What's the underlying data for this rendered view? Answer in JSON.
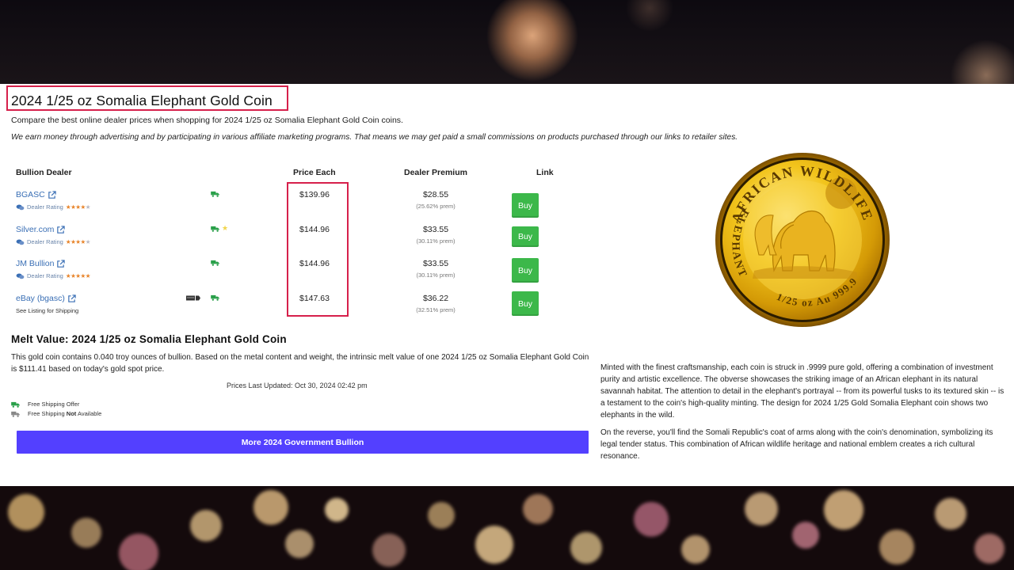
{
  "page": {
    "title": "2024 1/25 oz Somalia Elephant Gold Coin",
    "intro": "Compare the best online dealer prices when shopping for 2024 1/25 oz Somalia Elephant Gold Coin coins.",
    "disclaimer": "We earn money through advertising and by participating in various affiliate marketing programs. That means we may get paid a small commissions on products purchased through our links to retailer sites."
  },
  "table": {
    "headers": {
      "dealer": "Bullion Dealer",
      "price": "Price Each",
      "premium": "Dealer Premium",
      "link": "Link"
    },
    "rows": [
      {
        "dealer": "BGASC",
        "rating_label": "Dealer Rating",
        "stars": "★★★★",
        "stars_dim": "★",
        "price": "$139.96",
        "premium": "$28.55",
        "premium_pct": "(25.62% prem)",
        "buy": "Buy"
      },
      {
        "dealer": "Silver.com",
        "rating_label": "Dealer Rating",
        "stars": "★★★★",
        "stars_dim": "★",
        "price": "$144.96",
        "premium": "$33.55",
        "premium_pct": "(30.11% prem)",
        "buy": "Buy"
      },
      {
        "dealer": "JM Bullion",
        "rating_label": "Dealer Rating",
        "stars": "★★★★★",
        "stars_dim": "",
        "price": "$144.96",
        "premium": "$33.55",
        "premium_pct": "(30.11% prem)",
        "buy": "Buy"
      },
      {
        "dealer": "eBay (bgasc)",
        "sub": "See Listing for Shipping",
        "price": "$147.63",
        "premium": "$36.22",
        "premium_pct": "(32.51% prem)",
        "buy": "Buy"
      }
    ]
  },
  "melt": {
    "title": "Melt Value: 2024 1/25 oz Somalia Elephant Gold Coin",
    "text": "This gold coin contains 0.040 troy ounces of bullion. Based on the metal content and weight, the intrinsic melt value of one 2024 1/25 oz Somalia Elephant Gold Coin is $111.41 based on today's gold spot price.",
    "updated": "Prices Last Updated: Oct 30, 2024 02:42 pm"
  },
  "legend": {
    "free_shipping": "Free Shipping Offer",
    "not_available_prefix": "Free Shipping ",
    "not_available_bold": "Not",
    "not_available_suffix": " Available"
  },
  "more_button": "More 2024 Government Bullion",
  "coin": {
    "top_text": "AFRICAN WILDLIFE",
    "left_text": "ELEPHANT",
    "bottom_text": "1/25 oz Au 999.9"
  },
  "description": {
    "p1": "Minted with the finest craftsmanship, each coin is struck in .9999 pure gold, offering a combination of investment purity and artistic excellence. The obverse showcases the striking image of an African elephant in its natural savannah habitat. The attention to detail in the elephant's portrayal -- from its powerful tusks to its textured skin -- is a testament to the coin's high-quality minting. The design for 2024 1/25 Gold Somalia Elephant coin shows two elephants in the wild.",
    "p2": "On the reverse, you'll find the Somali Republic's coat of arms along with the coin's denomination, symbolizing its legal tender status. This combination of African wildlife heritage and national emblem creates a rich cultural resonance."
  },
  "colors": {
    "highlight": "#d6204b",
    "link": "#3a6fb5",
    "buy": "#3cb84a",
    "cta": "#5340ff",
    "truck_free": "#2aa04a",
    "truck_na": "#888888"
  },
  "icons": [
    "external-link-icon",
    "chat-icon",
    "truck-icon",
    "star-icon",
    "card-icon"
  ]
}
